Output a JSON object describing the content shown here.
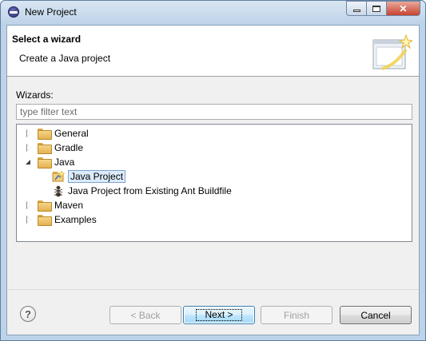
{
  "window": {
    "title": "New Project"
  },
  "banner": {
    "title": "Select a wizard",
    "description": "Create a Java project",
    "image_icon": "wizard-banner-icon"
  },
  "wizards_label": "Wizards:",
  "filter": {
    "placeholder": "type filter text",
    "value": ""
  },
  "tree": {
    "items": [
      {
        "label": "General",
        "expanded": false,
        "icon": "folder-icon",
        "level": 0
      },
      {
        "label": "Gradle",
        "expanded": false,
        "icon": "folder-icon",
        "level": 0
      },
      {
        "label": "Java",
        "expanded": true,
        "icon": "folder-icon",
        "level": 0
      },
      {
        "label": "Java Project",
        "icon": "java-project-icon",
        "level": 1,
        "selected": true
      },
      {
        "label": "Java Project from Existing Ant Buildfile",
        "icon": "ant-icon",
        "level": 1
      },
      {
        "label": "Maven",
        "expanded": false,
        "icon": "folder-icon",
        "level": 0
      },
      {
        "label": "Examples",
        "expanded": false,
        "icon": "folder-icon",
        "level": 0
      }
    ]
  },
  "buttons": {
    "help": "?",
    "back": "< Back",
    "next": "Next >",
    "finish": "Finish",
    "cancel": "Cancel"
  },
  "colors": {
    "selection_bg": "#dcebfc",
    "selection_border": "#7da2ce",
    "default_button": "#a7d9f5"
  }
}
